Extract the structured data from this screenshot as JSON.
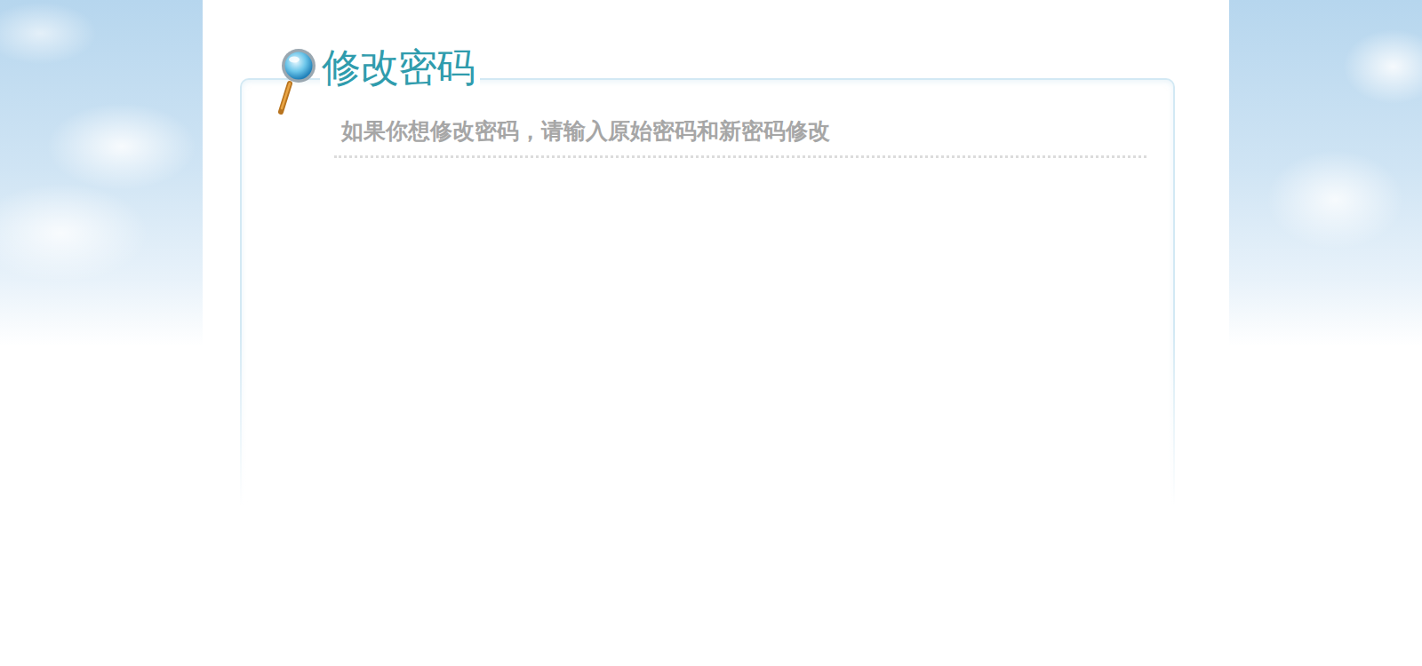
{
  "page": {
    "title": "修改密码",
    "subtitle": "如果你想修改密码，请输入原始密码和新密码修改"
  }
}
